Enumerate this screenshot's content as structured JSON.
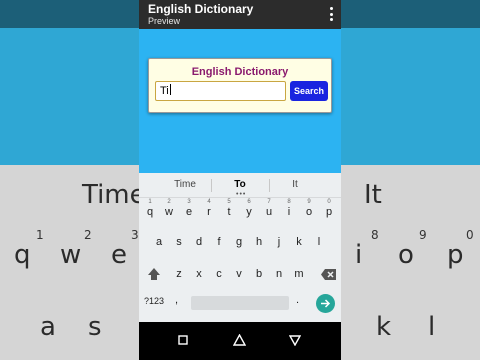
{
  "app": {
    "title": "English Dictionary",
    "subtitle": "Preview",
    "menu_icon": "more-vert-icon"
  },
  "card": {
    "title": "English Dictionary",
    "search_value": "Ti",
    "search_button_label": "Search"
  },
  "keyboard": {
    "suggestions": [
      "Time",
      "To",
      "It"
    ],
    "hints": [
      "1",
      "2",
      "3",
      "4",
      "5",
      "6",
      "7",
      "8",
      "9",
      "0"
    ],
    "row1": [
      "q",
      "w",
      "e",
      "r",
      "t",
      "y",
      "u",
      "i",
      "o",
      "p"
    ],
    "row2": [
      "a",
      "s",
      "d",
      "f",
      "g",
      "h",
      "j",
      "k",
      "l"
    ],
    "row3": [
      "z",
      "x",
      "c",
      "v",
      "b",
      "n",
      "m"
    ],
    "symbols_label": "?123",
    "comma": ",",
    "period": ".",
    "shift_icon": "shift-icon",
    "backspace_icon": "backspace-icon",
    "enter_icon": "arrow-right-icon"
  },
  "background": {
    "suggestions": [
      "Time",
      "It"
    ],
    "hints": [
      "1",
      "2",
      "3",
      "8",
      "9",
      "0"
    ],
    "row1": [
      "q",
      "w",
      "e",
      "i",
      "o",
      "p"
    ],
    "row2": [
      "a",
      "s",
      "k",
      "l"
    ]
  },
  "navbar": {
    "icons": [
      "recents-icon",
      "home-icon",
      "back-icon"
    ]
  },
  "colors": {
    "app_bar": "#2c2c2c",
    "content_bg": "#2cb3f2",
    "card_bg": "#fffee4",
    "card_title": "#8a1a6e",
    "search_button": "#1a24e0",
    "enter_key": "#26a69a",
    "keyboard_bg": "#eceff1"
  }
}
